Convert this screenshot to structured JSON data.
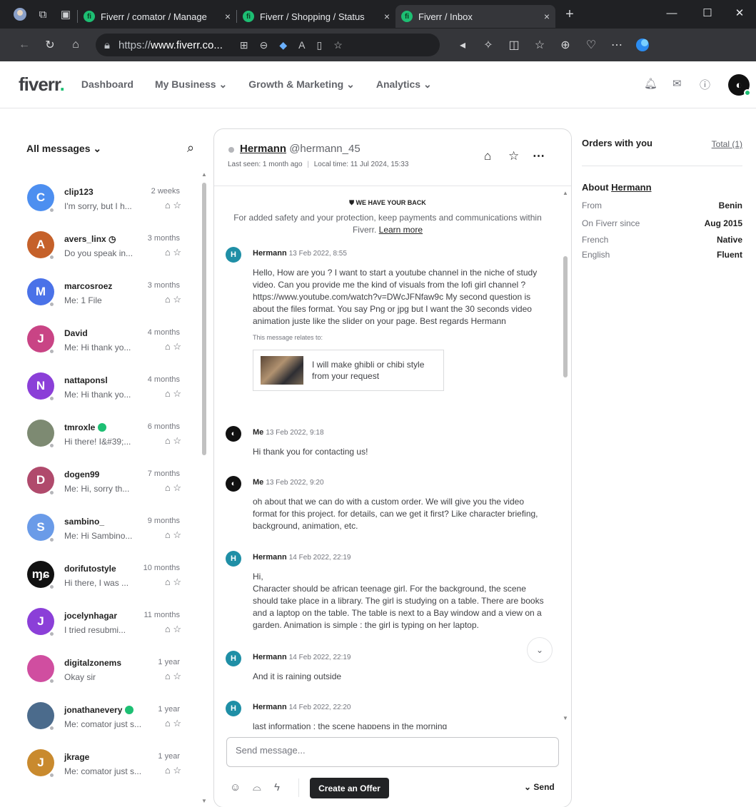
{
  "browser": {
    "tabs": [
      {
        "title": "Fiverr / comator / Manage",
        "close": "×"
      },
      {
        "title": "Fiverr / Shopping / Status",
        "close": "×"
      },
      {
        "title": "Fiverr / Inbox",
        "close": "×"
      }
    ],
    "new_tab": "+",
    "url_prefix": "https://",
    "url_domain": "www.fiverr.co...",
    "window_controls": {
      "minimize": "—",
      "maximize": "☐",
      "close": "✕"
    }
  },
  "header": {
    "logo": "fiverr",
    "logo_dot": ".",
    "nav": [
      "Dashboard",
      "My Business ⌄",
      "Growth & Marketing ⌄",
      "Analytics ⌄"
    ]
  },
  "sidebar": {
    "filter_label": "All messages ⌄",
    "conversations": [
      {
        "initial": "C",
        "color": "#4d8ff0",
        "name": "clip123",
        "time": "2 weeks",
        "preview": "I'm sorry, but I h..."
      },
      {
        "initial": "A",
        "color": "#c5612a",
        "name": "avers_linx ◷",
        "time": "3 months",
        "preview": "Do you speak in..."
      },
      {
        "initial": "M",
        "color": "#4a72e8",
        "name": "marcosroez",
        "time": "3 months",
        "preview": "Me: 1 File"
      },
      {
        "initial": "J",
        "color": "#c94485",
        "name": "David",
        "time": "4 months",
        "preview": "Me: Hi thank yo..."
      },
      {
        "initial": "N",
        "color": "#8b3fd8",
        "name": "nattaponsl",
        "time": "4 months",
        "preview": "Me: Hi thank yo..."
      },
      {
        "initial": "",
        "color": "#7d8a72",
        "name": "tmroxle",
        "time": "6 months",
        "preview": "Hi there! I&#39;...",
        "pro": true
      },
      {
        "initial": "D",
        "color": "#b04a6c",
        "name": "dogen99",
        "time": "7 months",
        "preview": "Me: Hi, sorry th..."
      },
      {
        "initial": "S",
        "color": "#6a9be8",
        "name": "sambino_",
        "time": "9 months",
        "preview": "Me: Hi Sambino..."
      },
      {
        "initial": "ɱɕ",
        "color": "#111111",
        "name": "dorifutostyle",
        "time": "10 months",
        "preview": "Hi there, I was ..."
      },
      {
        "initial": "J",
        "color": "#8b3fd8",
        "name": "jocelynhagar",
        "time": "11 months",
        "preview": "I tried resubmi..."
      },
      {
        "initial": "",
        "color": "#d04ea0",
        "name": "digitalzonems",
        "time": "1 year",
        "preview": "Okay sir"
      },
      {
        "initial": "",
        "color": "#4b6b8c",
        "name": "jonathanevery",
        "time": "1 year",
        "preview": "Me: comator just s...",
        "pro": true
      },
      {
        "initial": "J",
        "color": "#c98a2e",
        "name": "jkrage",
        "time": "1 year",
        "preview": "Me: comator just s..."
      }
    ]
  },
  "chat": {
    "contact_name": "Hermann",
    "contact_handle": "@hermann_45",
    "last_seen": "Last seen: 1 month ago",
    "meta_sep": "|",
    "local_time": "Local time: 11 Jul 2024, 15:33",
    "safety_title": "WE HAVE YOUR BACK",
    "safety_text": "For added safety and your protection, keep payments and communications within Fiverr.",
    "safety_link": "Learn more",
    "messages": [
      {
        "sender": "Hermann",
        "date": "13 Feb 2022, 8:55",
        "text": "Hello, How are you ? I want to start a youtube channel in the niche of study video. Can you provide me the kind of visuals from the lofi girl channel ? https://www.youtube.com/watch?v=DWcJFNfaw9c My second question is about the files format. You say Png or jpg but I want the 30 seconds video animation juste like the slider on your page. Best regards Hermann",
        "relates_label": "This message relates to:",
        "gig_title": "I will make ghibli or chibi style from your request"
      },
      {
        "sender": "Me",
        "date": "13 Feb 2022, 9:18",
        "text": "Hi thank you for contacting us!"
      },
      {
        "sender": "Me",
        "date": "13 Feb 2022, 9:20",
        "text": "oh about that we can do with a custom order. We will give you the video format for this project. for details, can we get it first? Like character briefing, background, animation, etc."
      },
      {
        "sender": "Hermann",
        "date": "14 Feb 2022, 22:19",
        "text_line1": "Hi,",
        "text": "Character should be african teenage girl. For the background, the scene should take place in a library. The girl is studying on a table. There are books and a laptop on the table. The table is next to a Bay window and a view on a garden. Animation is simple : the girl is typing on her laptop."
      },
      {
        "sender": "Hermann",
        "date": "14 Feb 2022, 22:19",
        "text": "And it is raining outside"
      },
      {
        "sender": "Hermann",
        "date": "14 Feb 2022, 22:20",
        "text": "last information : the scene happens in the morning"
      }
    ],
    "compose_placeholder": "Send message...",
    "create_offer_label": "Create an Offer",
    "send_label": "Send",
    "send_chevron": "⌄"
  },
  "sidepanel": {
    "orders_title": "Orders with you",
    "orders_total": "Total (1)",
    "about_prefix": "About",
    "about_name": "Hermann",
    "details": [
      {
        "label": "From",
        "value": "Benin"
      },
      {
        "label": "On Fiverr since",
        "value": "Aug 2015"
      },
      {
        "label": "French",
        "value": "Native"
      },
      {
        "label": "English",
        "value": "Fluent"
      }
    ]
  },
  "colors": {
    "brand": "#1dbf73",
    "button_dark": "#222325",
    "browser_dark": "#202124"
  }
}
